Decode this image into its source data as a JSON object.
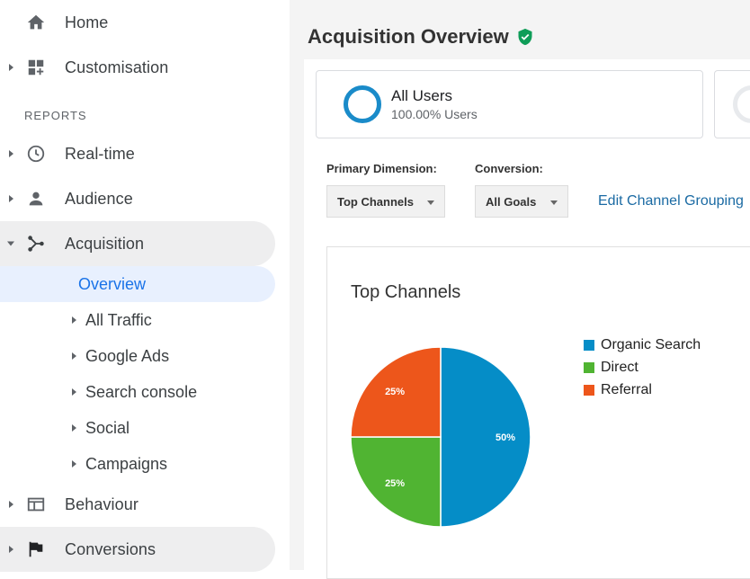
{
  "sidebar": {
    "home": "Home",
    "customisation": "Customisation",
    "reports_heading": "REPORTS",
    "realtime": "Real-time",
    "audience": "Audience",
    "acquisition": "Acquisition",
    "overview": "Overview",
    "all_traffic": "All Traffic",
    "google_ads": "Google Ads",
    "search_console": "Search console",
    "social": "Social",
    "campaigns": "Campaigns",
    "behaviour": "Behaviour",
    "conversions": "Conversions"
  },
  "main": {
    "title": "Acquisition Overview",
    "segment": {
      "name": "All Users",
      "subtitle": "100.00% Users"
    },
    "primary_dimension_label": "Primary Dimension:",
    "primary_dimension_value": "Top Channels",
    "conversion_label": "Conversion:",
    "conversion_value": "All Goals",
    "edit_link": "Edit Channel Grouping"
  },
  "colors": {
    "accent_blue": "#1a73e8",
    "verified_green": "#0f9d58",
    "organic": "#058dc7",
    "direct": "#50b432",
    "referral": "#ed561b"
  },
  "icons": {
    "home": "home-icon",
    "customisation": "dashboard-add-icon",
    "realtime": "clock-icon",
    "audience": "person-icon",
    "acquisition": "acquisition-icon",
    "behaviour": "window-icon",
    "conversions": "flag-icon",
    "verified": "verified-shield-icon"
  },
  "chart_data": {
    "type": "pie",
    "title": "Top Channels",
    "categories": [
      "Organic Search",
      "Direct",
      "Referral"
    ],
    "values": [
      50,
      25,
      25
    ],
    "labels": [
      "50%",
      "25%",
      "25%"
    ],
    "colors": [
      "#058dc7",
      "#50b432",
      "#ed561b"
    ],
    "legend": "right"
  }
}
